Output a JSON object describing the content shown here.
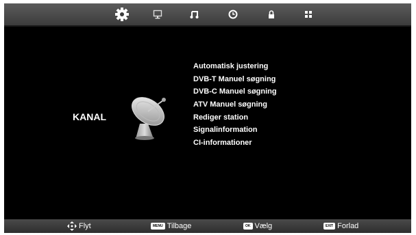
{
  "top_tabs": [
    {
      "name": "settings-icon",
      "active": true
    },
    {
      "name": "picture-icon",
      "active": false
    },
    {
      "name": "sound-icon",
      "active": false
    },
    {
      "name": "time-icon",
      "active": false
    },
    {
      "name": "lock-icon",
      "active": false
    },
    {
      "name": "apps-icon",
      "active": false
    }
  ],
  "section": {
    "title": "KANAL"
  },
  "menu": {
    "items": [
      "Automatisk justering",
      "DVB-T Manuel søgning",
      "DVB-C Manuel søgning",
      "ATV Manuel søgning",
      "Rediger station",
      "Signalinformation",
      "CI-informationer"
    ]
  },
  "footer": {
    "move": {
      "label": "Flyt"
    },
    "back": {
      "key": "MENU",
      "label": "Tilbage"
    },
    "select": {
      "key": "OK",
      "label": "Vælg"
    },
    "exit": {
      "key": "EXIT",
      "label": "Forlad"
    }
  },
  "colors": {
    "background": "#000000",
    "bar": "#4a4a4a",
    "text": "#ffffff"
  }
}
